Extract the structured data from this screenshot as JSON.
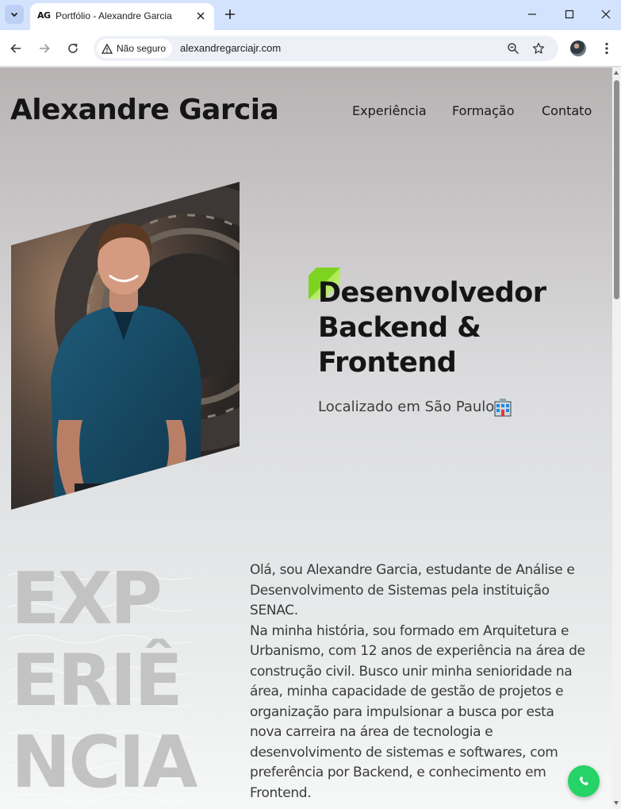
{
  "browser": {
    "tab": {
      "favicon_text": "AG",
      "title": "Portfólio - Alexandre Garcia"
    },
    "security_label": "Não seguro",
    "url": "alexandregarciajr.com",
    "icons": {
      "tab_list": "chevron-down-icon",
      "tab_close": "close-icon",
      "new_tab": "plus-icon",
      "minimize": "minimize-icon",
      "maximize": "maximize-icon",
      "window_close": "close-icon",
      "back": "arrow-left-icon",
      "forward": "arrow-right-icon",
      "reload": "reload-icon",
      "warning": "warning-icon",
      "zoom": "zoom-icon",
      "bookmark": "star-icon",
      "menu": "more-vert-icon"
    }
  },
  "site": {
    "name": "Alexandre Garcia",
    "nav": [
      "Experiência",
      "Formação",
      "Contato"
    ],
    "hero": {
      "headline_lines": [
        "Desenvolvedor",
        "Backend &",
        "Frontend"
      ],
      "location": "Localizado em São Paulo",
      "location_icon": "city-icon",
      "accent_color": "#7ed321"
    },
    "section_title_lines": [
      "EXP",
      "ERIÊ",
      "NCIA"
    ],
    "about_lines": [
      "Olá, sou Alexandre Garcia, estudante de Análise e",
      "Desenvolvimento de Sistemas pela instituição",
      "SENAC.",
      "Na minha história, sou formado em Arquitetura e",
      "Urbanismo, com 12 anos de experiência na área de",
      "construção civil. Busco unir minha senioridade na",
      "área, minha capacidade de gestão de projetos e",
      "organização para impulsionar a busca por esta",
      "nova carreira na área de tecnologia e",
      "desenvolvimento de sistemas e softwares, com",
      "preferência por Backend, e conhecimento em",
      "Frontend."
    ],
    "whatsapp_icon": "whatsapp-icon",
    "whatsapp_color": "#25d366"
  }
}
